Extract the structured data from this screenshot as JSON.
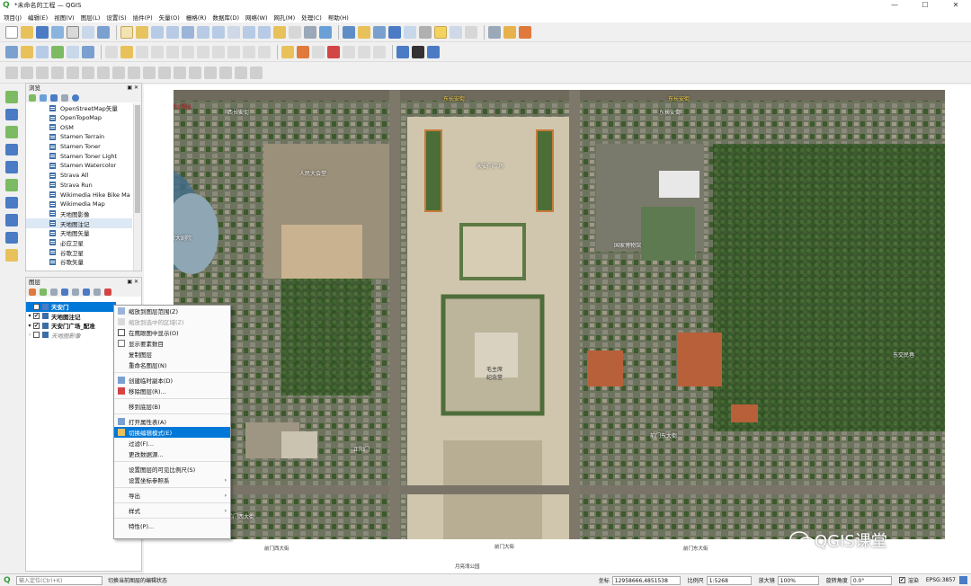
{
  "window": {
    "title": "*未命名的工程 — QGIS",
    "app_glyph": "Q",
    "min": "—",
    "max": "☐",
    "close": "✕"
  },
  "menu": [
    "项目(J)",
    "编辑(E)",
    "视图(V)",
    "图层(L)",
    "设置(S)",
    "插件(P)",
    "矢量(O)",
    "栅格(R)",
    "数据库(D)",
    "网络(W)",
    "网孔(M)",
    "处理(C)",
    "帮助(H)"
  ],
  "browser": {
    "title": "浏览",
    "items": [
      "OpenStreetMap矢量",
      "OpenTopoMap",
      "OSM",
      "Stamen Terrain",
      "Stamen Toner",
      "Stamen Toner Light",
      "Stamen Watercolor",
      "Strava All",
      "Strava Run",
      "Wikimedia Hike Bike Ma",
      "Wikimedia Map",
      "天地图影像",
      "天地图注记",
      "天地图矢量",
      "必应卫星",
      "谷歌卫星",
      "谷歌矢量"
    ]
  },
  "layers": {
    "title": "图层",
    "items": [
      {
        "label": "天安门",
        "checked": "✔",
        "bold": true,
        "selected": true
      },
      {
        "label": "天地图注记",
        "checked": "✔",
        "bold": true
      },
      {
        "label": "天安门广场_配准",
        "checked": "✔",
        "bold": true
      },
      {
        "label": "天地图影像",
        "checked": "",
        "bold": false
      }
    ]
  },
  "context_menu": [
    {
      "label": "缩放到图层范围(Z)",
      "disabled": false
    },
    {
      "label": "缩放到选中的区域(Z)",
      "disabled": true
    },
    {
      "label": "在鹰眼图中显示(O)",
      "disabled": false
    },
    {
      "label": "显示要素数目",
      "disabled": false
    },
    {
      "label": "复制图层",
      "disabled": false
    },
    {
      "label": "重命名图层(N)",
      "disabled": false
    },
    {
      "sep": true
    },
    {
      "label": "创建临时副本(D)",
      "disabled": false
    },
    {
      "label": "移除图层(R)...",
      "disabled": false
    },
    {
      "sep": true
    },
    {
      "label": "移到底层(B)",
      "disabled": false
    },
    {
      "sep": true
    },
    {
      "label": "打开属性表(A)",
      "disabled": false
    },
    {
      "label": "切换编辑模式(E)",
      "disabled": false,
      "highlight": true
    },
    {
      "label": "过滤(F)...",
      "disabled": false
    },
    {
      "label": "更改数据源...",
      "disabled": false
    },
    {
      "sep": true
    },
    {
      "label": "设置图层的可见比例尺(S)",
      "disabled": false
    },
    {
      "label": "设置坐标参照系",
      "disabled": false,
      "sub": true
    },
    {
      "sep": true
    },
    {
      "label": "导出",
      "disabled": false,
      "sub": true
    },
    {
      "sep": true
    },
    {
      "label": "样式",
      "disabled": false,
      "sub": true
    },
    {
      "sep": true
    },
    {
      "label": "特性(P)...",
      "disabled": false
    }
  ],
  "map_labels": {
    "tam_square": "天安门广场",
    "mausoleum": "毛主席\n纪念堂",
    "museum": "国家博物馆",
    "theater": "国家大剧院",
    "great_hall": "人民大会堂",
    "east_chang_an": "东长安街",
    "west_chang_an": "西长安街",
    "qianmen_east": "前门东大街",
    "qianmen_west": "前门西大街",
    "zhengyang": "正阳门",
    "xidan": "地铁1号线",
    "yuehe": "月亮湾公园",
    "bottom_left": "前门大街",
    "chaoyang": "东交民巷"
  },
  "status": {
    "locator_placeholder": "输入定位(Ctrl+K)",
    "message": "切换当前图层的编辑状态",
    "coord_label": "坐标",
    "coord_value": "12958666,4851538",
    "scale_label": "比例尺",
    "scale_value": "1:5268",
    "magnifier_label": "放大镜",
    "magnifier_value": "100%",
    "rotation_label": "旋转角度",
    "rotation_value": "0.0°",
    "render_label": "渲染",
    "render_checked": "✔",
    "crs": "EPSG:3857"
  },
  "watermark": "QGIS课堂"
}
